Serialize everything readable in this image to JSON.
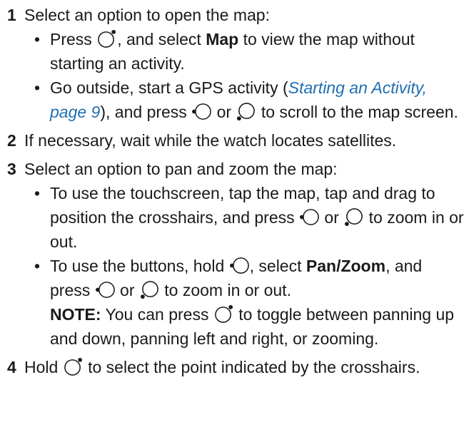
{
  "steps": [
    {
      "num": "1",
      "text": "Select an option to open the map:",
      "sub1": {
        "bullet": "•",
        "a": "Press ",
        "b": ", and select ",
        "bold": "Map",
        "c": " to view the map without starting an activity."
      },
      "sub2": {
        "bullet": "•",
        "a": "Go outside, start a GPS activity (",
        "link": "Starting an Activity, page 9",
        "b": "), and press ",
        "c": " or ",
        "d": " to scroll to the map screen."
      }
    },
    {
      "num": "2",
      "text": "If necessary, wait while the watch locates satellites."
    },
    {
      "num": "3",
      "text": "Select an option to pan and zoom the map:",
      "sub1": {
        "bullet": "•",
        "a": "To use the touchscreen, tap the map, tap and drag to position the crosshairs, and press ",
        "b": " or ",
        "c": " to zoom in or out."
      },
      "sub2": {
        "bullet": "•",
        "a": "To use the buttons, hold ",
        "b": ", select ",
        "bold": "Pan/Zoom",
        "c": ", and press ",
        "d": " or ",
        "e": " to zoom in or out.",
        "note_label": "NOTE:",
        "note_a": " You can press ",
        "note_b": " to toggle between panning up and down, panning left and right, or zooming."
      }
    },
    {
      "num": "4",
      "text_a": "Hold ",
      "text_b": " to select the point indicated by the crosshairs."
    }
  ],
  "colors": {
    "link": "#1e6fb3",
    "text": "#1a1a1a"
  },
  "icons": {
    "top_right": "watch-button-top-right-icon",
    "left": "watch-button-left-icon",
    "bottom_left": "watch-button-bottom-left-icon"
  }
}
